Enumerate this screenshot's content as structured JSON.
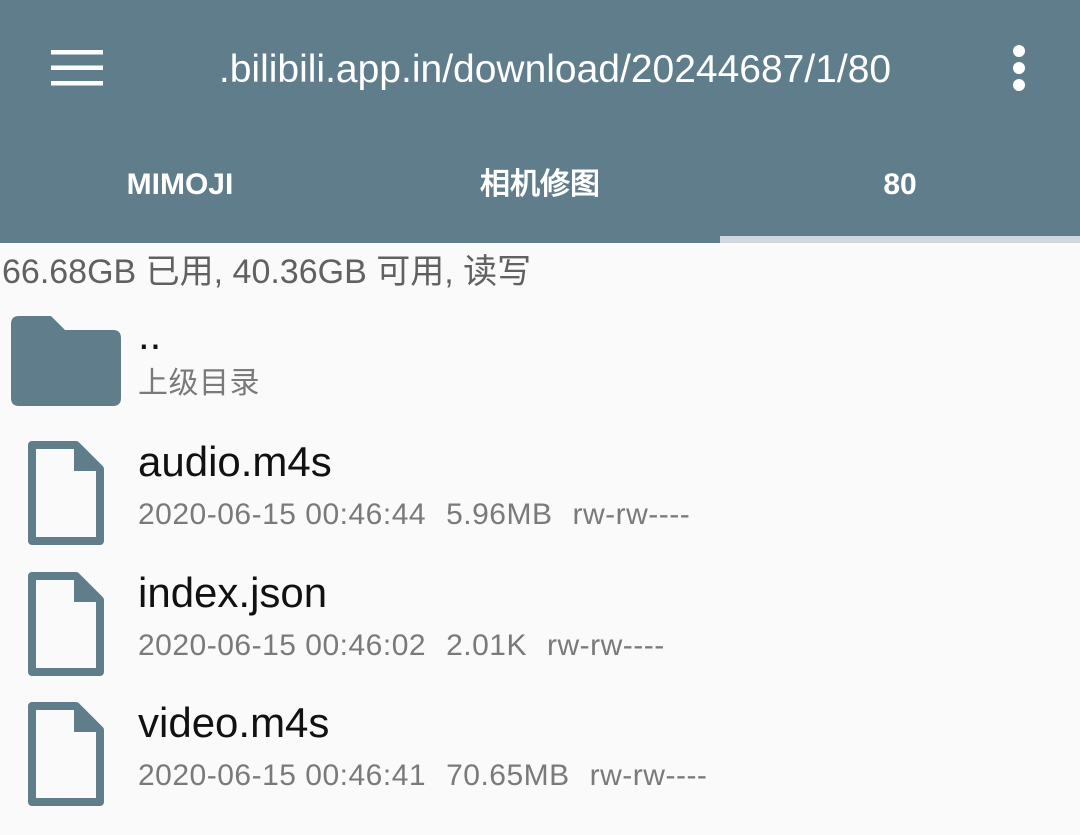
{
  "header": {
    "path": ".bilibili.app.in/download/20244687/1/80",
    "menu_icon": "menu-icon",
    "overflow_icon": "more-vert-icon",
    "background": "#607d8b"
  },
  "tabs": [
    {
      "label": "MIMOJI",
      "selected": false
    },
    {
      "label": "相机修图",
      "selected": false
    },
    {
      "label": "80",
      "selected": true
    }
  ],
  "storage_info": "66.68GB 已用, 40.36GB 可用, 读写",
  "parent_dir": {
    "name": "..",
    "subtitle": "上级目录",
    "icon": "folder-icon"
  },
  "files": [
    {
      "name": "audio.m4s",
      "date": "2020-06-15 00:46:44",
      "size": "5.96MB",
      "perms": "rw-rw----",
      "icon": "file-icon"
    },
    {
      "name": "index.json",
      "date": "2020-06-15 00:46:02",
      "size": "2.01K",
      "perms": "rw-rw----",
      "icon": "file-icon"
    },
    {
      "name": "video.m4s",
      "date": "2020-06-15 00:46:41",
      "size": "70.65MB",
      "perms": "rw-rw----",
      "icon": "file-icon"
    }
  ]
}
